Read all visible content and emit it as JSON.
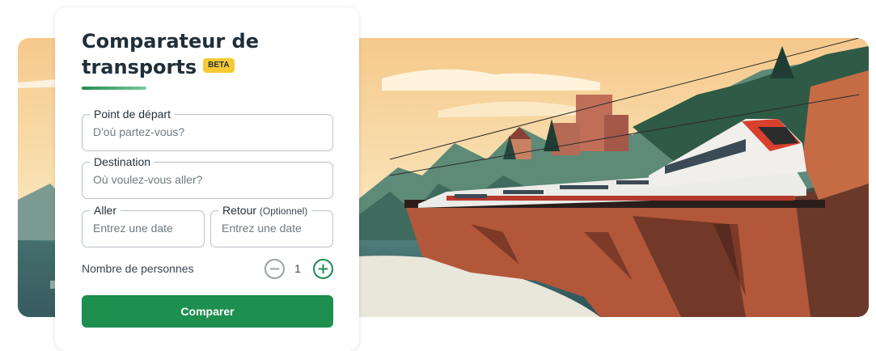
{
  "card": {
    "title_line1": "Comparateur de",
    "title_line2": "transports",
    "beta_badge": "BETA"
  },
  "departure": {
    "label": "Point de départ",
    "placeholder": "D'où partez-vous?"
  },
  "destination": {
    "label": "Destination",
    "placeholder": "Où voulez-vous aller?"
  },
  "outbound": {
    "label": "Aller",
    "placeholder": "Entrez une date"
  },
  "return": {
    "label": "Retour",
    "optional": "(Optionnel)",
    "placeholder": "Entrez une date"
  },
  "persons": {
    "label": "Nombre de personnes",
    "count": "1"
  },
  "submit_label": "Comparer",
  "colors": {
    "primary": "#1d8f4e",
    "badge": "#f7c934",
    "title": "#1f2f3a"
  },
  "icons": {
    "decrement": "minus-circle-icon",
    "increment": "plus-circle-icon"
  },
  "banner_illustration": "train-on-coastal-cliff-illustration"
}
